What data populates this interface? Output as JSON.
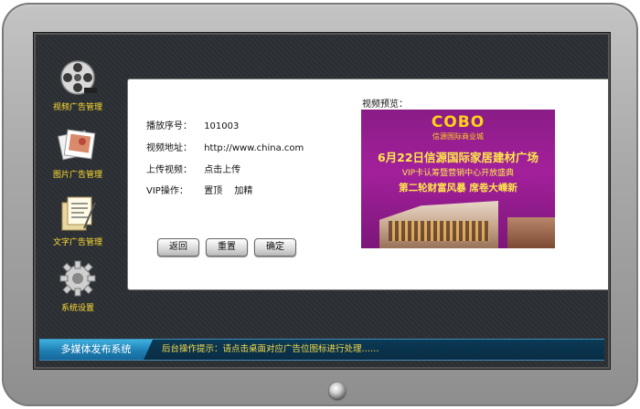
{
  "sidebar": {
    "items": [
      {
        "label": "视频广告管理",
        "icon": "film-reel-icon"
      },
      {
        "label": "图片广告管理",
        "icon": "photos-icon"
      },
      {
        "label": "文字广告管理",
        "icon": "documents-icon"
      },
      {
        "label": "系统设置",
        "icon": "gear-icon"
      }
    ]
  },
  "form": {
    "serial_label": "播放序号：",
    "serial_value": "101003",
    "url_label": "视频地址：",
    "url_value": "http://www.china.com",
    "upload_label": "上传视频：",
    "upload_link": "点击上传",
    "vip_label": "VIP操作：",
    "vip_top": "置顶",
    "vip_featured": "加精"
  },
  "buttons": {
    "back": "返回",
    "reset": "重置",
    "confirm": "确定"
  },
  "preview": {
    "label": "视频预览：",
    "brand": "COBO",
    "brand_sub": "信源国际商业城",
    "line1": "6月22日信源国际家居建材广场",
    "line2": "VIP卡认筹暨营销中心开放盛典",
    "line3": "第二轮财富风暴 席卷大嵊新"
  },
  "footer": {
    "system_title": "多媒体发布系统",
    "hint": "后台操作提示：请点击桌面对应广告位图标进行处理……"
  },
  "colors": {
    "sidebar_label": "#ffdd33",
    "hint_text": "#f7dc4a",
    "screen_bg": "#2b2f34",
    "title_bar": "#1f7fb4"
  }
}
